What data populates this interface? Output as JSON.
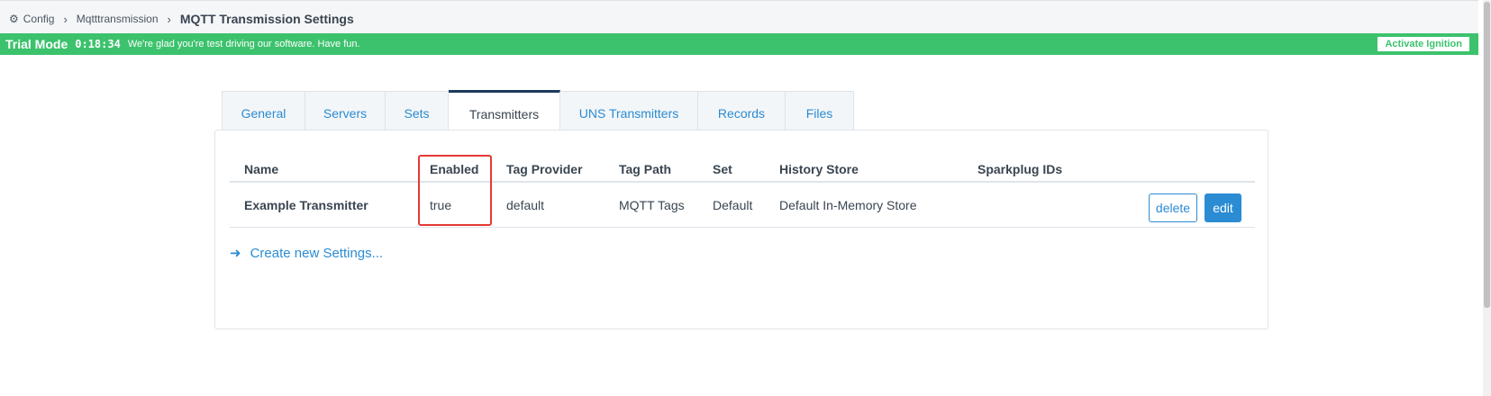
{
  "breadcrumb": {
    "gear_icon": "gear-icon",
    "config": "Config",
    "module": "Mqtttransmission",
    "current": "MQTT Transmission Settings",
    "separator": "›"
  },
  "trial": {
    "label": "Trial Mode",
    "time": "0:18:34",
    "message": "We're glad you're test driving our software. Have fun.",
    "activate": "Activate Ignition",
    "color": "#3cc26d"
  },
  "tabs": [
    {
      "label": "General",
      "active": false
    },
    {
      "label": "Servers",
      "active": false
    },
    {
      "label": "Sets",
      "active": false
    },
    {
      "label": "Transmitters",
      "active": true
    },
    {
      "label": "UNS Transmitters",
      "active": false
    },
    {
      "label": "Records",
      "active": false
    },
    {
      "label": "Files",
      "active": false
    }
  ],
  "table": {
    "headers": {
      "name": "Name",
      "enabled": "Enabled",
      "tag_provider": "Tag Provider",
      "tag_path": "Tag Path",
      "set": "Set",
      "history_store": "History Store",
      "sparkplug_ids": "Sparkplug IDs"
    },
    "rows": [
      {
        "name": "Example Transmitter",
        "enabled": "true",
        "tag_provider": "default",
        "tag_path": "MQTT Tags",
        "set": "Default",
        "history_store": "Default In-Memory Store",
        "sparkplug_ids": "",
        "delete_label": "delete",
        "edit_label": "edit"
      }
    ]
  },
  "create_link": {
    "arrow": "➜",
    "label": "Create new Settings..."
  },
  "colors": {
    "accent": "#2b8bd3",
    "highlight": "#e53935"
  }
}
